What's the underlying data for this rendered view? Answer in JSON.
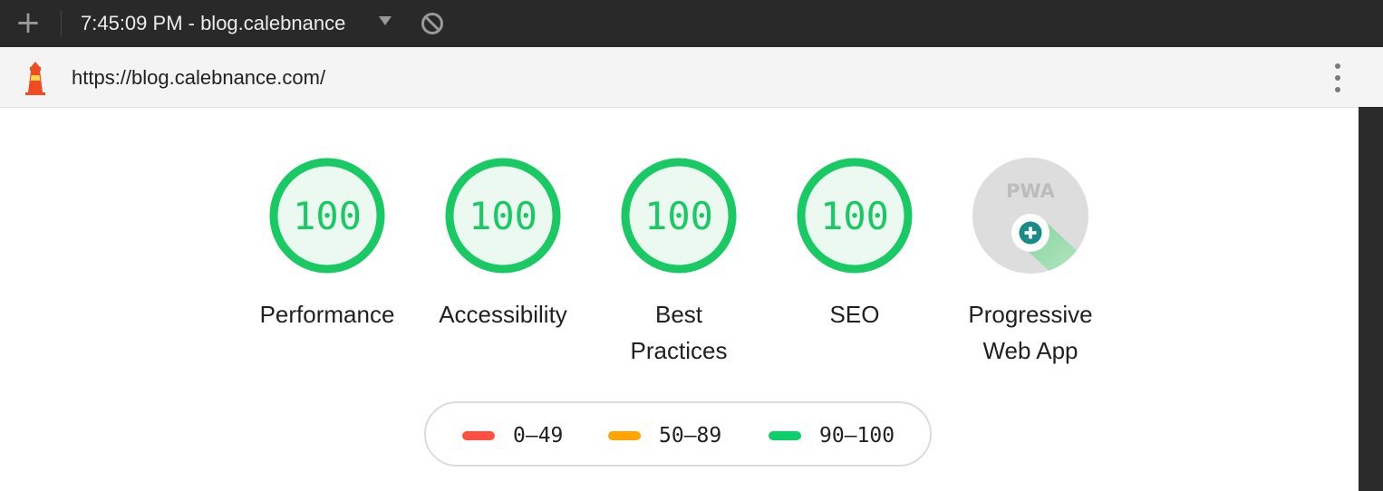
{
  "toolbar": {
    "new_report_icon": "plus-icon",
    "report_selector": "7:45:09 PM - blog.calebnance",
    "clear_icon": "no-entry-icon"
  },
  "urlbar": {
    "logo_icon": "lighthouse-icon",
    "url": "https://blog.calebnance.com/",
    "menu_icon": "kebab-menu-icon"
  },
  "colors": {
    "pass": "#0cce6b",
    "average": "#ffa400",
    "fail": "#ff4e42"
  },
  "gauges": [
    {
      "score": "100",
      "label": "Performance",
      "value": 100
    },
    {
      "score": "100",
      "label": "Accessibility",
      "value": 100
    },
    {
      "score": "100",
      "label_line1": "Best",
      "label_line2": "Practices",
      "value": 100
    },
    {
      "score": "100",
      "label": "SEO",
      "value": 100
    },
    {
      "badge_text": "PWA",
      "label_line1": "Progressive",
      "label_line2": "Web App",
      "icon": "pwa-badge-icon"
    }
  ],
  "legend": [
    {
      "range": "0–49",
      "color": "#ff4e42"
    },
    {
      "range": "50–89",
      "color": "#ffa400"
    },
    {
      "range": "90–100",
      "color": "#0cce6b"
    }
  ]
}
